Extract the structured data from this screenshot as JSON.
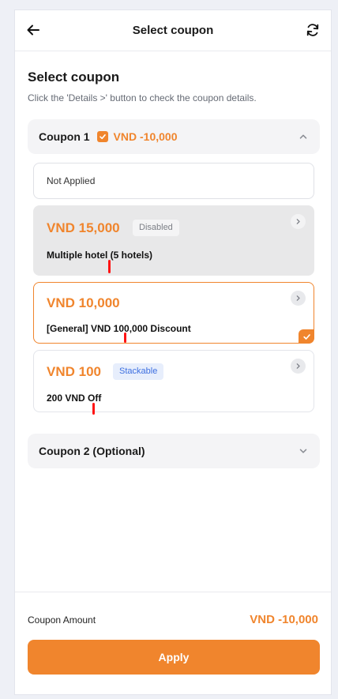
{
  "header": {
    "title": "Select coupon",
    "back_icon": "arrow-left-icon",
    "refresh_icon": "refresh-icon"
  },
  "section": {
    "title": "Select coupon",
    "description": "Click the 'Details >' button to check the coupon details."
  },
  "coupon1": {
    "label": "Coupon 1",
    "applied_amount": "VND -10,000",
    "expanded": true
  },
  "not_applied_label": "Not Applied",
  "coupons": [
    {
      "price": "VND 15,000",
      "badge": "Disabled",
      "name": "Multiple hotel (5 hotels)",
      "state": "disabled"
    },
    {
      "price": "VND 10,000",
      "badge": "",
      "name": "[General] VND 100,000 Discount",
      "state": "selected"
    },
    {
      "price": "VND 100",
      "badge": "Stackable",
      "name": "200 VND Off",
      "state": "available"
    }
  ],
  "coupon2": {
    "label": "Coupon 2 (Optional)",
    "expanded": false
  },
  "footer": {
    "amount_label": "Coupon Amount",
    "amount_value": "VND -10,000",
    "apply_label": "Apply"
  },
  "colors": {
    "accent": "#f0852d",
    "stackable_badge": "#3d6fe0",
    "annotation_mark": "#ff1414"
  }
}
